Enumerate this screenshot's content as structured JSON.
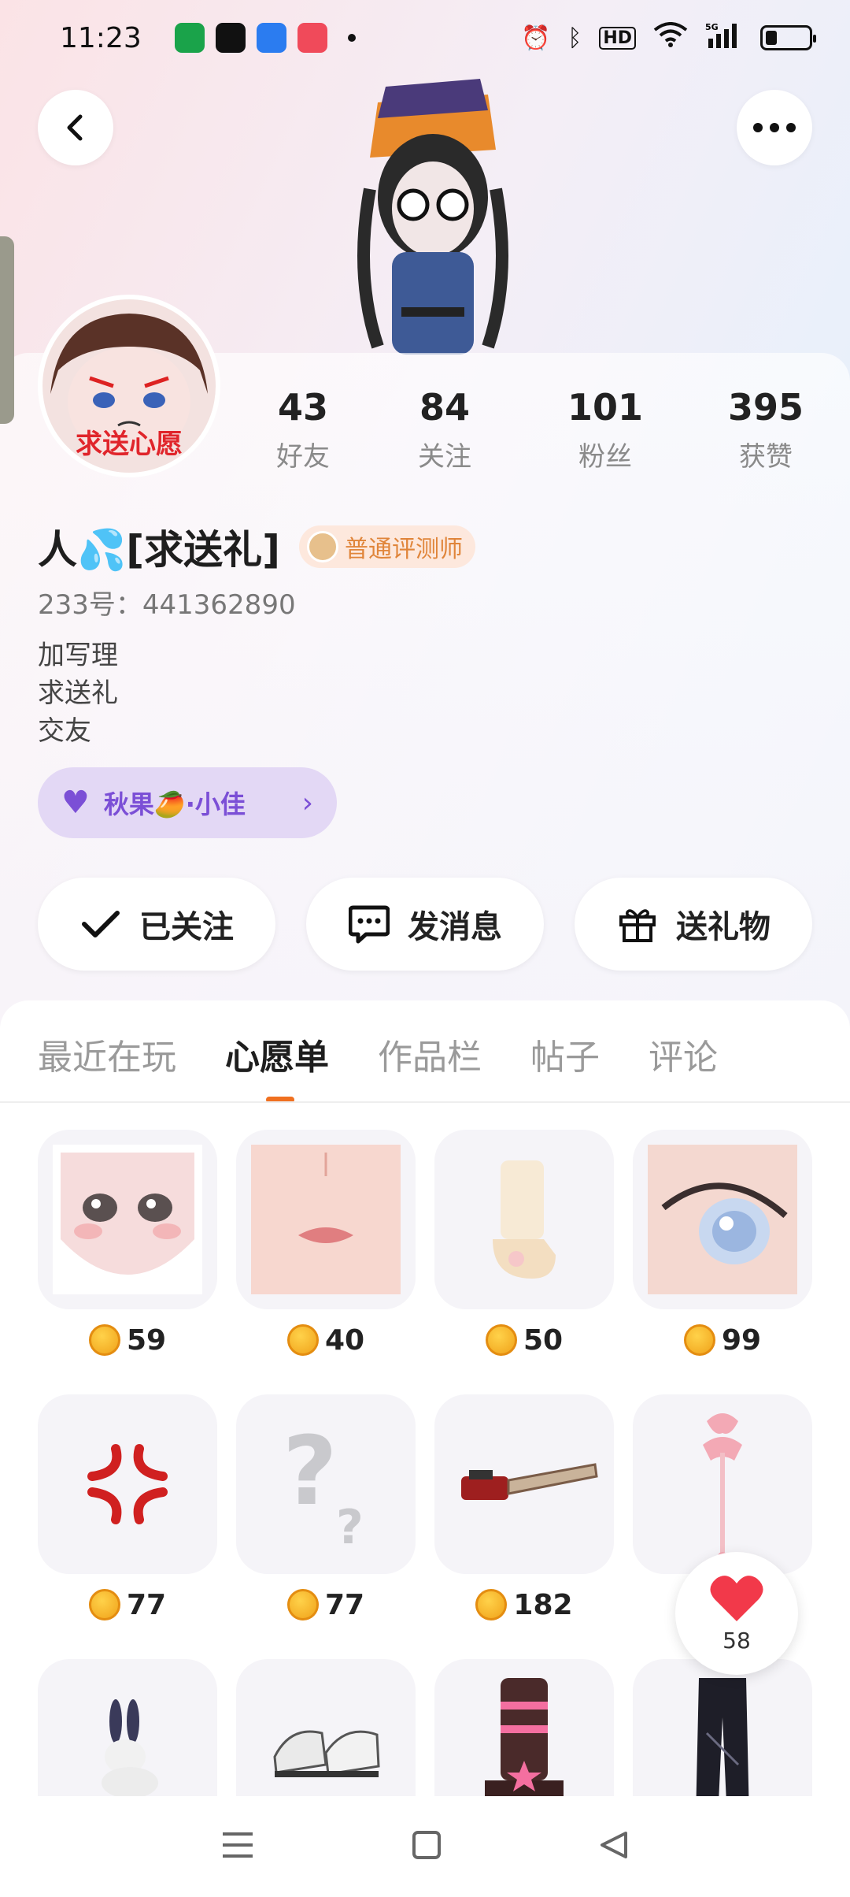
{
  "status_bar": {
    "time": "11:23",
    "indicators": [
      "alarm-icon",
      "bluetooth-icon",
      "HD",
      "wifi-icon",
      "5G",
      "signal-icon",
      "battery-icon"
    ]
  },
  "header": {
    "back_icon": "back-arrow-icon",
    "more_icon": "more-dots-icon"
  },
  "profile": {
    "avatar_badge": "求送心愿",
    "name": "人💦[求送礼]",
    "title_badge": "普通评测师",
    "uid": "233号：441362890",
    "bio": [
      "加写理",
      "求送礼",
      "交友"
    ],
    "cp_chip": "秋果🥭·小佳",
    "cp_arrow": "›"
  },
  "stats": [
    {
      "value": "43",
      "label": "好友"
    },
    {
      "value": "84",
      "label": "关注"
    },
    {
      "value": "101",
      "label": "粉丝"
    },
    {
      "value": "395",
      "label": "获赞"
    }
  ],
  "actions": {
    "follow": "已关注",
    "message": "发消息",
    "gift": "送礼物"
  },
  "tabs": [
    "最近在玩",
    "心愿单",
    "作品栏",
    "帖子",
    "评论"
  ],
  "active_tab": "心愿单",
  "wishlist": [
    {
      "name": "face",
      "price": "59"
    },
    {
      "name": "lips",
      "price": "40"
    },
    {
      "name": "socks",
      "price": "50"
    },
    {
      "name": "eye",
      "price": "99"
    },
    {
      "name": "anger-mark",
      "price": "77"
    },
    {
      "name": "question-mark",
      "price": "77"
    },
    {
      "name": "chainsaw",
      "price": "182"
    },
    {
      "name": "bow-wand",
      "price": ""
    },
    {
      "name": "rabbit",
      "price": ""
    },
    {
      "name": "sneakers",
      "price": ""
    },
    {
      "name": "platform-boots",
      "price": ""
    },
    {
      "name": "black-pants",
      "price": ""
    }
  ],
  "like_fab": {
    "count": "58"
  },
  "colors": {
    "accent": "#f07020",
    "cp": "#7b4fd6",
    "badge_text": "#e0853a"
  }
}
